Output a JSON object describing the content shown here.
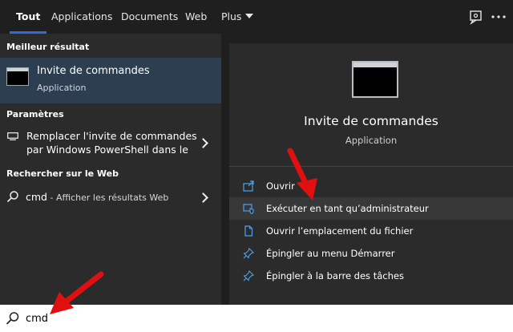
{
  "tabs": [
    {
      "label": "Tout",
      "active": true
    },
    {
      "label": "Applications"
    },
    {
      "label": "Documents"
    },
    {
      "label": "Web"
    },
    {
      "label": "Plus"
    }
  ],
  "left": {
    "best_header": "Meilleur résultat",
    "best_title": "Invite de commandes",
    "best_sub": "Application",
    "settings_header": "Paramètres",
    "settings_line1": "Remplacer l'invite de commandes",
    "settings_line2": "par Windows PowerShell dans le",
    "web_header": "Rechercher sur le Web",
    "web_query": "cmd",
    "web_suffix": " - Afficher les résultats Web"
  },
  "right": {
    "app_name": "Invite de commandes",
    "app_type": "Application",
    "actions": [
      {
        "label": "Ouvrir",
        "icon": "open-icon"
      },
      {
        "label": "Exécuter en tant qu’administrateur",
        "icon": "shield-icon"
      },
      {
        "label": "Ouvrir l’emplacement du fichier",
        "icon": "file-icon"
      },
      {
        "label": "Épingler au menu Démarrer",
        "icon": "pin-icon"
      },
      {
        "label": "Épingler à la barre des tâches",
        "icon": "pin-icon"
      }
    ]
  },
  "search": {
    "value": "cmd"
  },
  "colors": {
    "accent": "#2d6cdf",
    "selected_bg": "#2c3e50",
    "arrow": "#e01010"
  }
}
